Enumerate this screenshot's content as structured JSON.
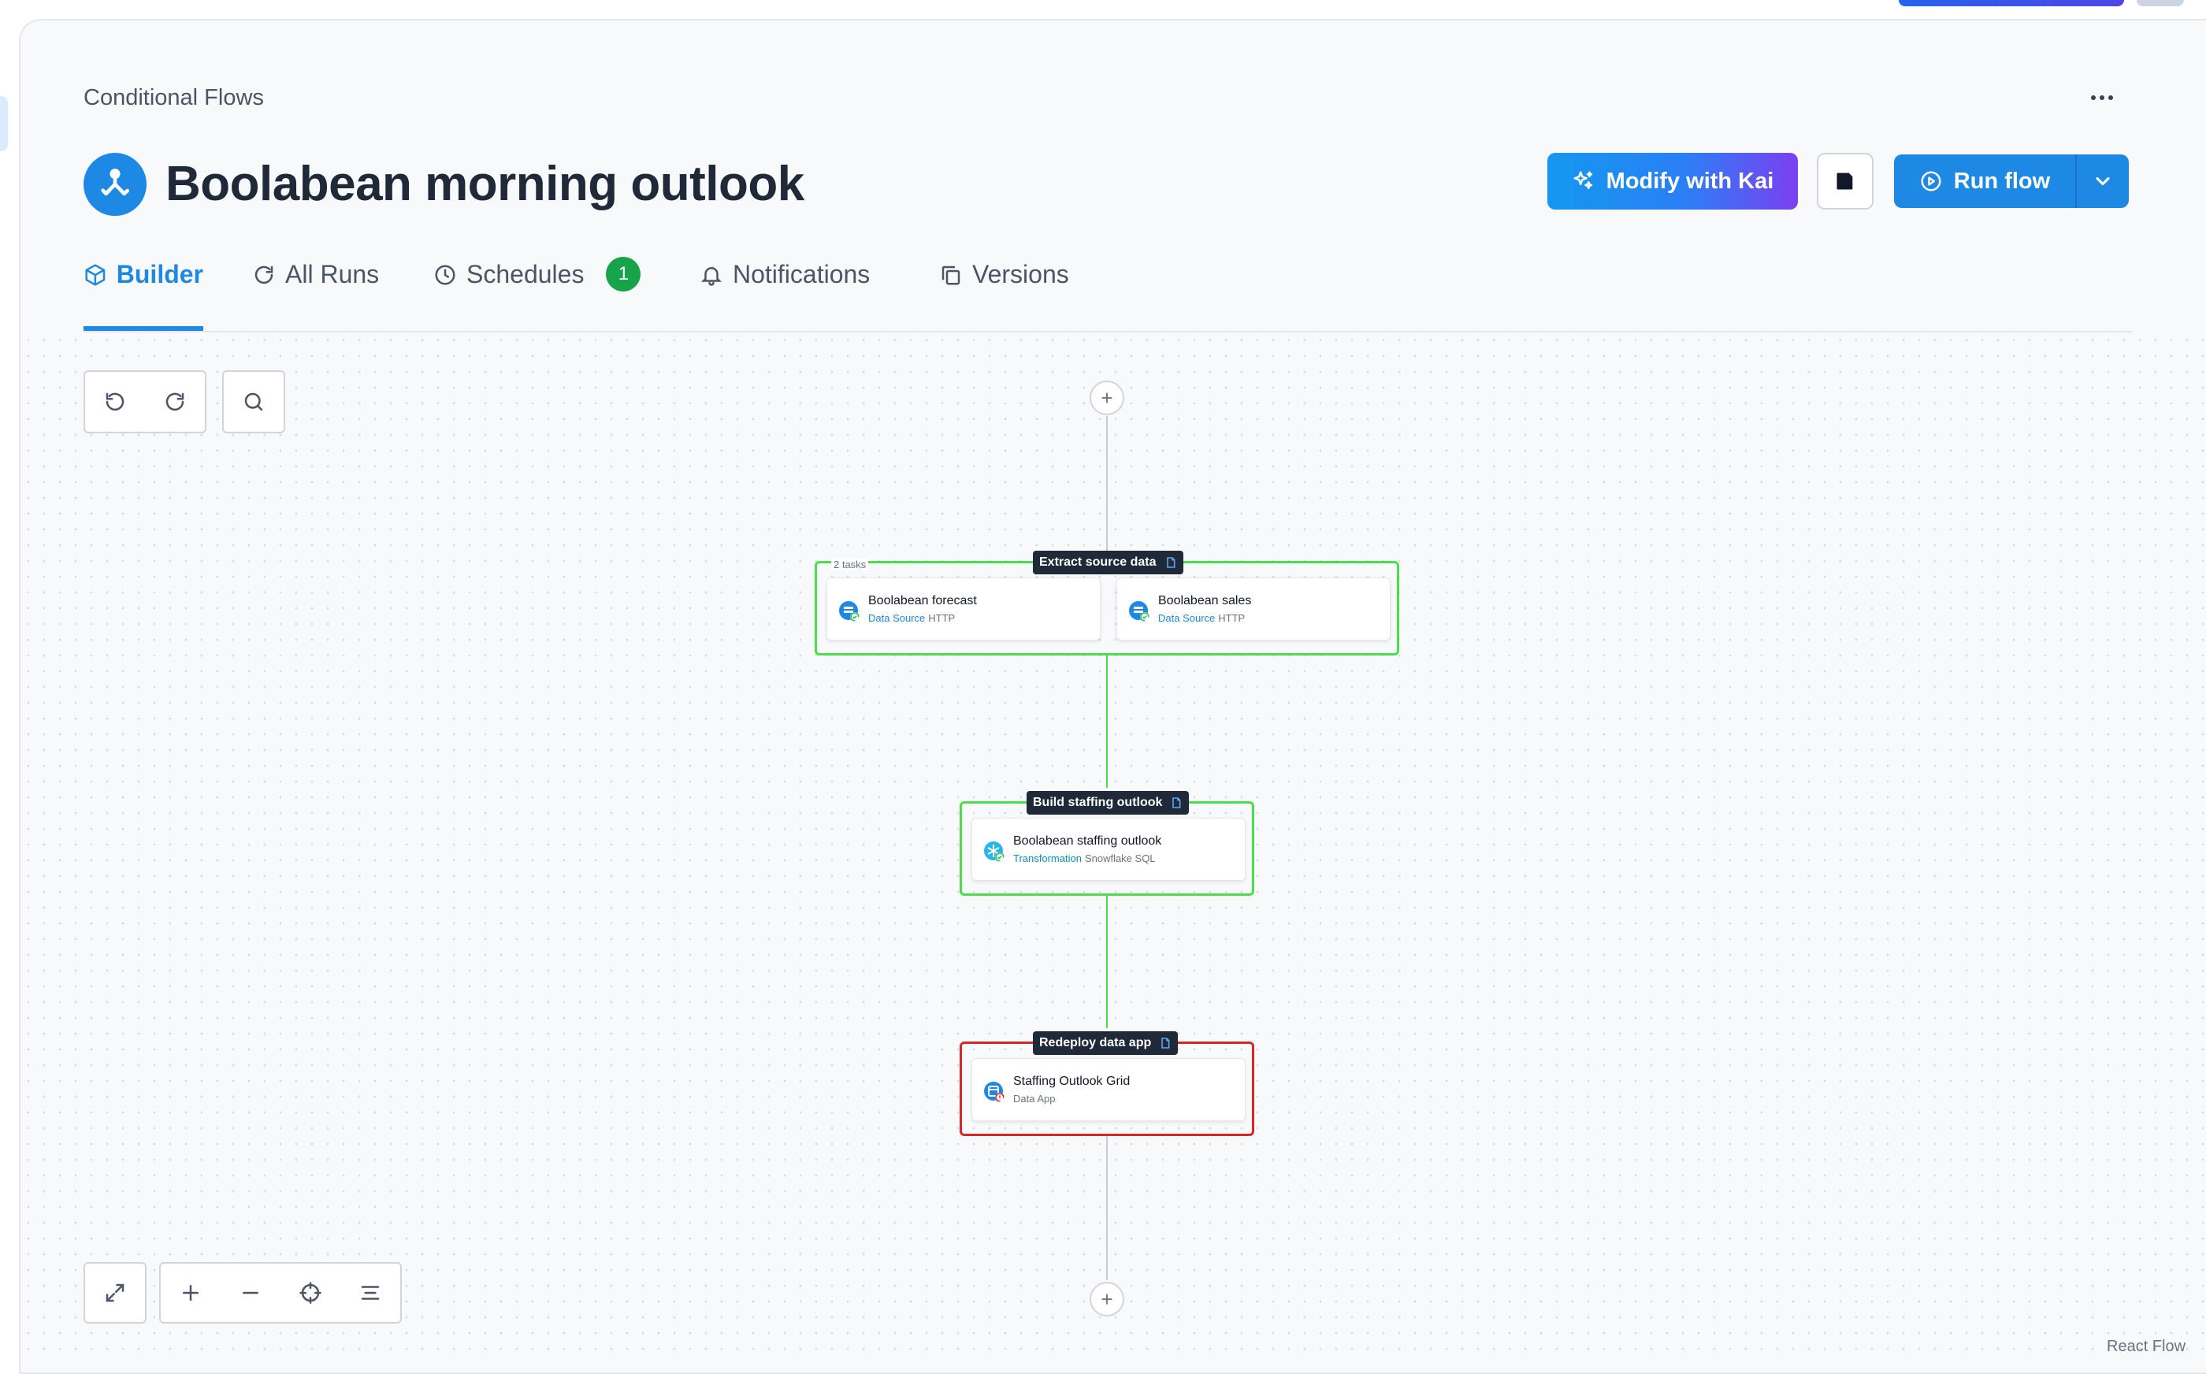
{
  "breadcrumb": "Conditional Flows",
  "page_title": "Boolabean morning outlook",
  "actions": {
    "modify_label": "Modify with Kai",
    "run_label": "Run flow"
  },
  "tabs": [
    {
      "label": "Builder",
      "icon": "cube-icon",
      "active": true
    },
    {
      "label": "All Runs",
      "icon": "refresh-icon"
    },
    {
      "label": "Schedules",
      "icon": "clock-icon",
      "badge": "1"
    },
    {
      "label": "Notifications",
      "icon": "bell-icon"
    },
    {
      "label": "Versions",
      "icon": "copy-icon"
    }
  ],
  "flow": {
    "phases": [
      {
        "label": "Extract source data",
        "count": "2 tasks",
        "status": "success",
        "tasks": [
          {
            "name": "Boolabean forecast",
            "kind": "Data Source",
            "detail": "HTTP",
            "status": "success"
          },
          {
            "name": "Boolabean sales",
            "kind": "Data Source",
            "detail": "HTTP",
            "status": "success"
          }
        ]
      },
      {
        "label": "Build staffing outlook",
        "status": "success",
        "tasks": [
          {
            "name": "Boolabean staffing outlook",
            "kind": "Transformation",
            "detail": "Snowflake SQL",
            "status": "success"
          }
        ]
      },
      {
        "label": "Redeploy data app",
        "status": "error",
        "tasks": [
          {
            "name": "Staffing Outlook Grid",
            "kind": "Data App",
            "detail": "",
            "status": "error"
          }
        ]
      }
    ]
  },
  "canvas": {
    "attribution": "React Flow",
    "add_symbol": "+"
  },
  "colors": {
    "accent": "#1e88e5",
    "success": "#4ade4a",
    "error": "#dc2626",
    "badge": "#16a34a"
  }
}
